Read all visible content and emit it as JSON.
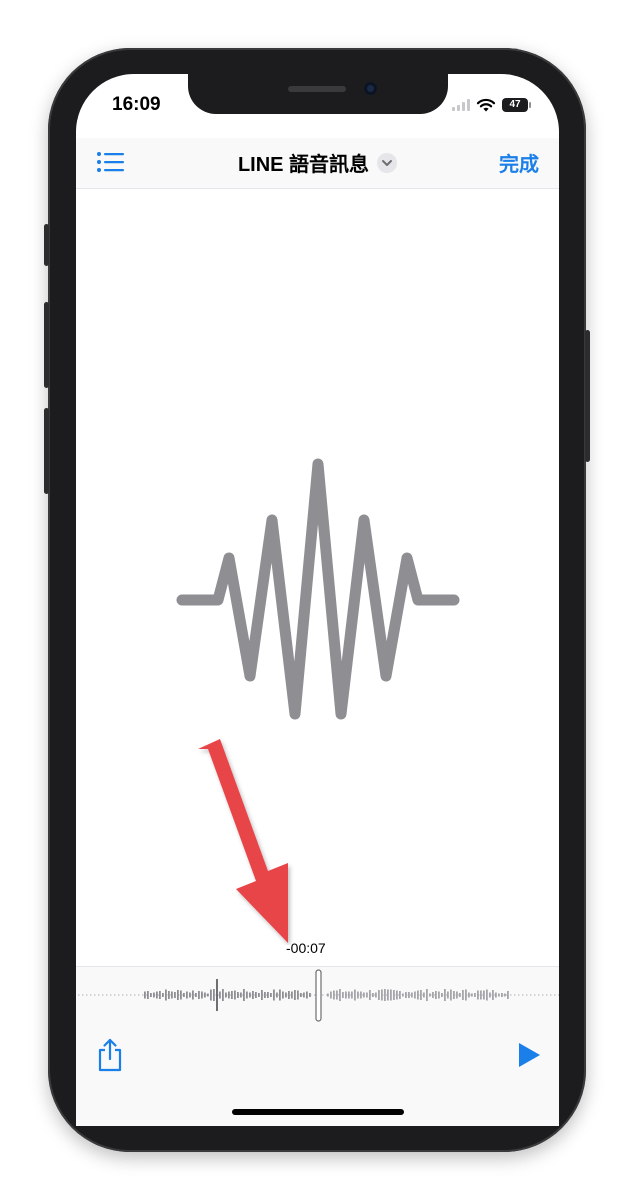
{
  "status_bar": {
    "time": "16:09",
    "battery": "47",
    "icons": [
      "wifi-icon",
      "battery-icon"
    ]
  },
  "navbar": {
    "title": "LINE 語音訊息",
    "done_label": "完成",
    "icons": [
      "list-icon",
      "chevron-down-icon"
    ]
  },
  "player": {
    "time_remaining": "-00:07",
    "icons": [
      "waveform-icon",
      "share-icon",
      "play-icon"
    ]
  },
  "colors": {
    "accent": "#1a7fe8",
    "waveform": "#8e8e93",
    "arrow": "#e8454a"
  }
}
